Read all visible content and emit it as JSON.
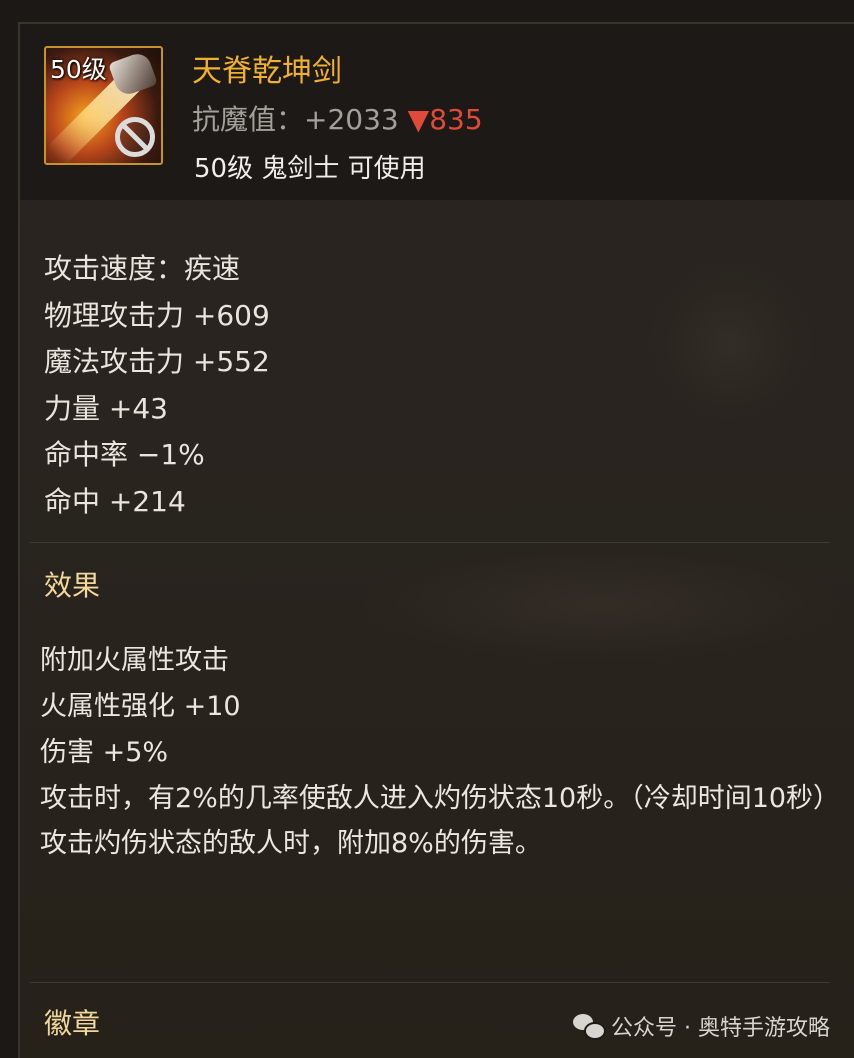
{
  "item": {
    "level_badge": "50级",
    "name": "天脊乾坤剑",
    "resist_label": "抗魔值：+2033",
    "resist_change_arrow": "▼",
    "resist_change_value": "835",
    "usable_text": "50级 鬼剑士 可使用",
    "icon_name": "sword-icon",
    "forbid_icon": "forbidden-icon"
  },
  "attributes": [
    "攻击速度：疾速",
    "物理攻击力 +609",
    "魔法攻击力 +552",
    "力量 +43",
    "命中率 −1%",
    "命中 +214"
  ],
  "effect_section": {
    "title": "效果",
    "lines": [
      "附加火属性攻击",
      "火属性强化 +10",
      "伤害 +5%",
      "攻击时，有2%的几率使敌人进入灼伤状态10秒。（冷却时间10秒）",
      "攻击灼伤状态的敌人时，附加8%的伤害。"
    ]
  },
  "badge_section": {
    "title": "徽章"
  },
  "watermark": {
    "text": "公众号 · 奥特手游攻略"
  },
  "colors": {
    "name": "#f0b030",
    "down_arrow": "#e04a3a",
    "section_title": "#f1d79b",
    "frame_border": "#c7922e"
  }
}
